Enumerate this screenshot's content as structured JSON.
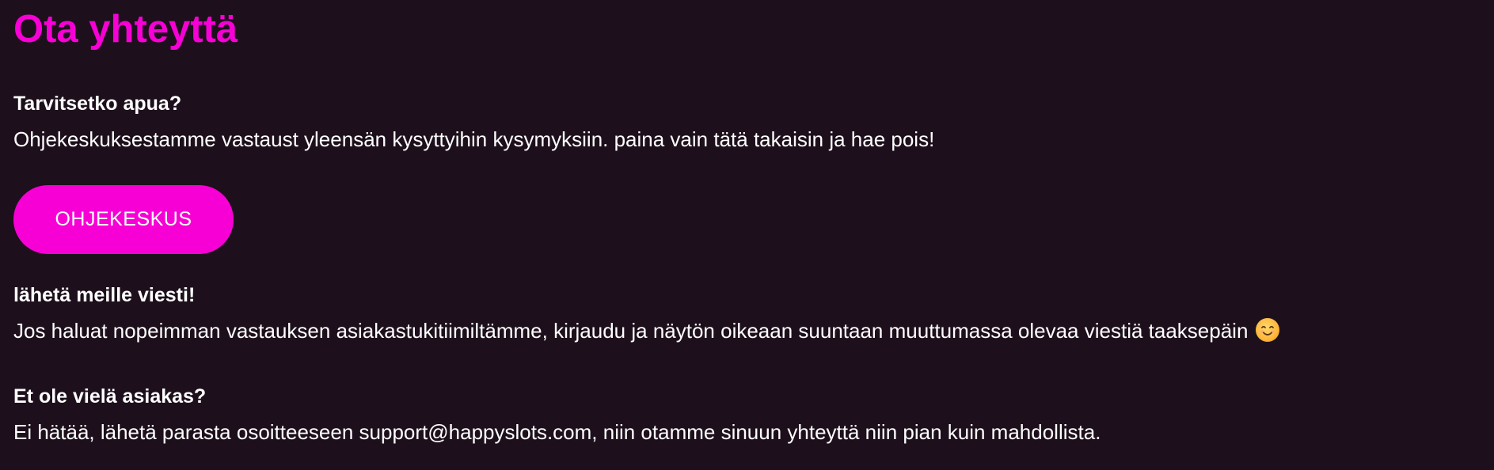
{
  "page": {
    "title": "Ota yhteyttä"
  },
  "help": {
    "heading": "Tarvitsetko apua?",
    "text": "Ohjekeskuksestamme vastaust yleensän kysyttyihin kysymyksiin. paina vain tätä takaisin ja hae pois!",
    "button_label": "OHJEKESKUS"
  },
  "message": {
    "heading": "lähetä meille viesti!",
    "text": "Jos haluat nopeimman vastauksen asiakastukitiimiltämme, kirjaudu ja näytön oikeaan suuntaan muuttumassa olevaa viestiä taaksepäin",
    "emoji_icon": "smiling-face-icon"
  },
  "not_customer": {
    "heading": "Et ole vielä asiakas?",
    "text": "Ei hätää, lähetä parasta osoitteeseen support@happyslots.com, niin otamme sinuun yhteyttä niin pian kuin mahdollista."
  },
  "colors": {
    "background": "#1d101c",
    "accent": "#f700d6",
    "text": "#ffffff"
  }
}
